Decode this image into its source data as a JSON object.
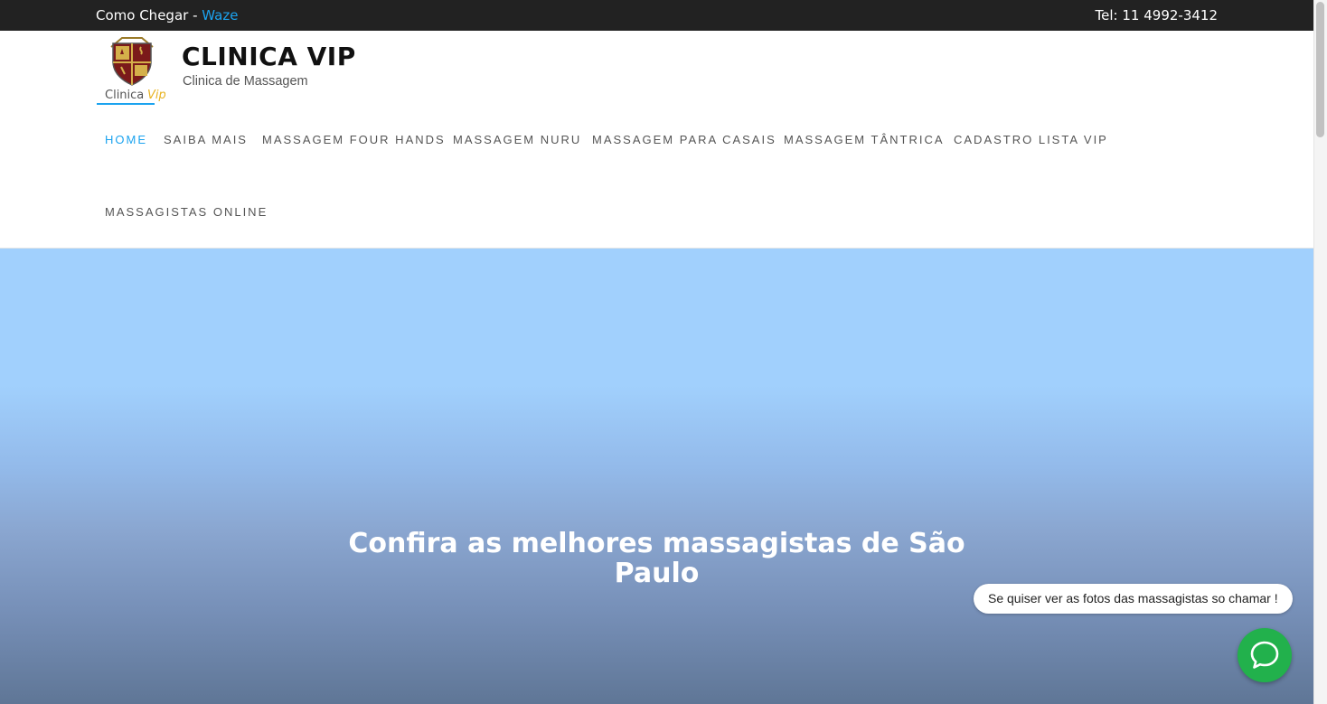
{
  "topbar": {
    "directions_label": "Como Chegar - ",
    "waze_link": "Waze",
    "phone": "Tel: 11 4992-3412"
  },
  "brand": {
    "title": "CLINICA VIP",
    "tagline": "Clinica de Massagem",
    "logo_text": "ClinicaVip"
  },
  "nav": {
    "items": [
      {
        "label": "HOME",
        "active": true
      },
      {
        "label": "SAIBA MAIS"
      },
      {
        "label": "MASSAGEM FOUR HANDS"
      },
      {
        "label": "MASSAGEM NURU"
      },
      {
        "label": "MASSAGEM PARA CASAIS"
      },
      {
        "label": "MASSAGEM TÂNTRICA"
      },
      {
        "label": "CADASTRO LISTA VIP"
      },
      {
        "label": "MASSAGISTAS ONLINE"
      }
    ]
  },
  "hero": {
    "title_line1": "Confira as melhores massagistas de  São",
    "title_line2": "Paulo"
  },
  "chat": {
    "bubble_text": "Se quiser ver as fotos das massagistas so chamar !",
    "button_icon": "whatsapp-chat-icon"
  },
  "colors": {
    "accent": "#1ba3ef",
    "topbar_bg": "#222222",
    "whatsapp_green": "#22b14c",
    "hero_top": "#a1d0fd"
  }
}
